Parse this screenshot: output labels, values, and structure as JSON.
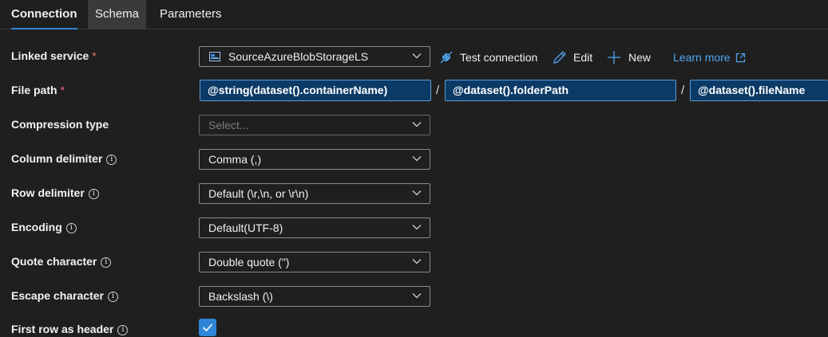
{
  "tabs": [
    {
      "label": "Connection"
    },
    {
      "label": "Schema"
    },
    {
      "label": "Parameters"
    }
  ],
  "linked_service": {
    "label": "Linked service",
    "required_mark": "*",
    "value": "SourceAzureBlobStorageLS",
    "test_connection": "Test connection",
    "edit": "Edit",
    "new": "New",
    "learn_more": "Learn more"
  },
  "file_path": {
    "label": "File path",
    "required_mark": "*",
    "container": "@string(dataset().containerName)",
    "folder": "@dataset().folderPath",
    "file": "@dataset().fileName",
    "separator": "/"
  },
  "fields": {
    "compression": {
      "label": "Compression type",
      "placeholder": "Select..."
    },
    "column_delimiter": {
      "label": "Column delimiter",
      "value": "Comma (,)"
    },
    "row_delimiter": {
      "label": "Row delimiter",
      "value": "Default (\\r,\\n, or \\r\\n)"
    },
    "encoding": {
      "label": "Encoding",
      "value": "Default(UTF-8)"
    },
    "quote_character": {
      "label": "Quote character",
      "value": "Double quote (\")"
    },
    "escape_character": {
      "label": "Escape character",
      "value": "Backslash (\\)"
    },
    "first_row_header": {
      "label": "First row as header",
      "checked": true
    }
  },
  "info_glyph": "i",
  "colors": {
    "accent": "#2f86d8",
    "required": "#f1707b",
    "link": "#4fa3f0",
    "expression_bg": "#0c3a66"
  }
}
